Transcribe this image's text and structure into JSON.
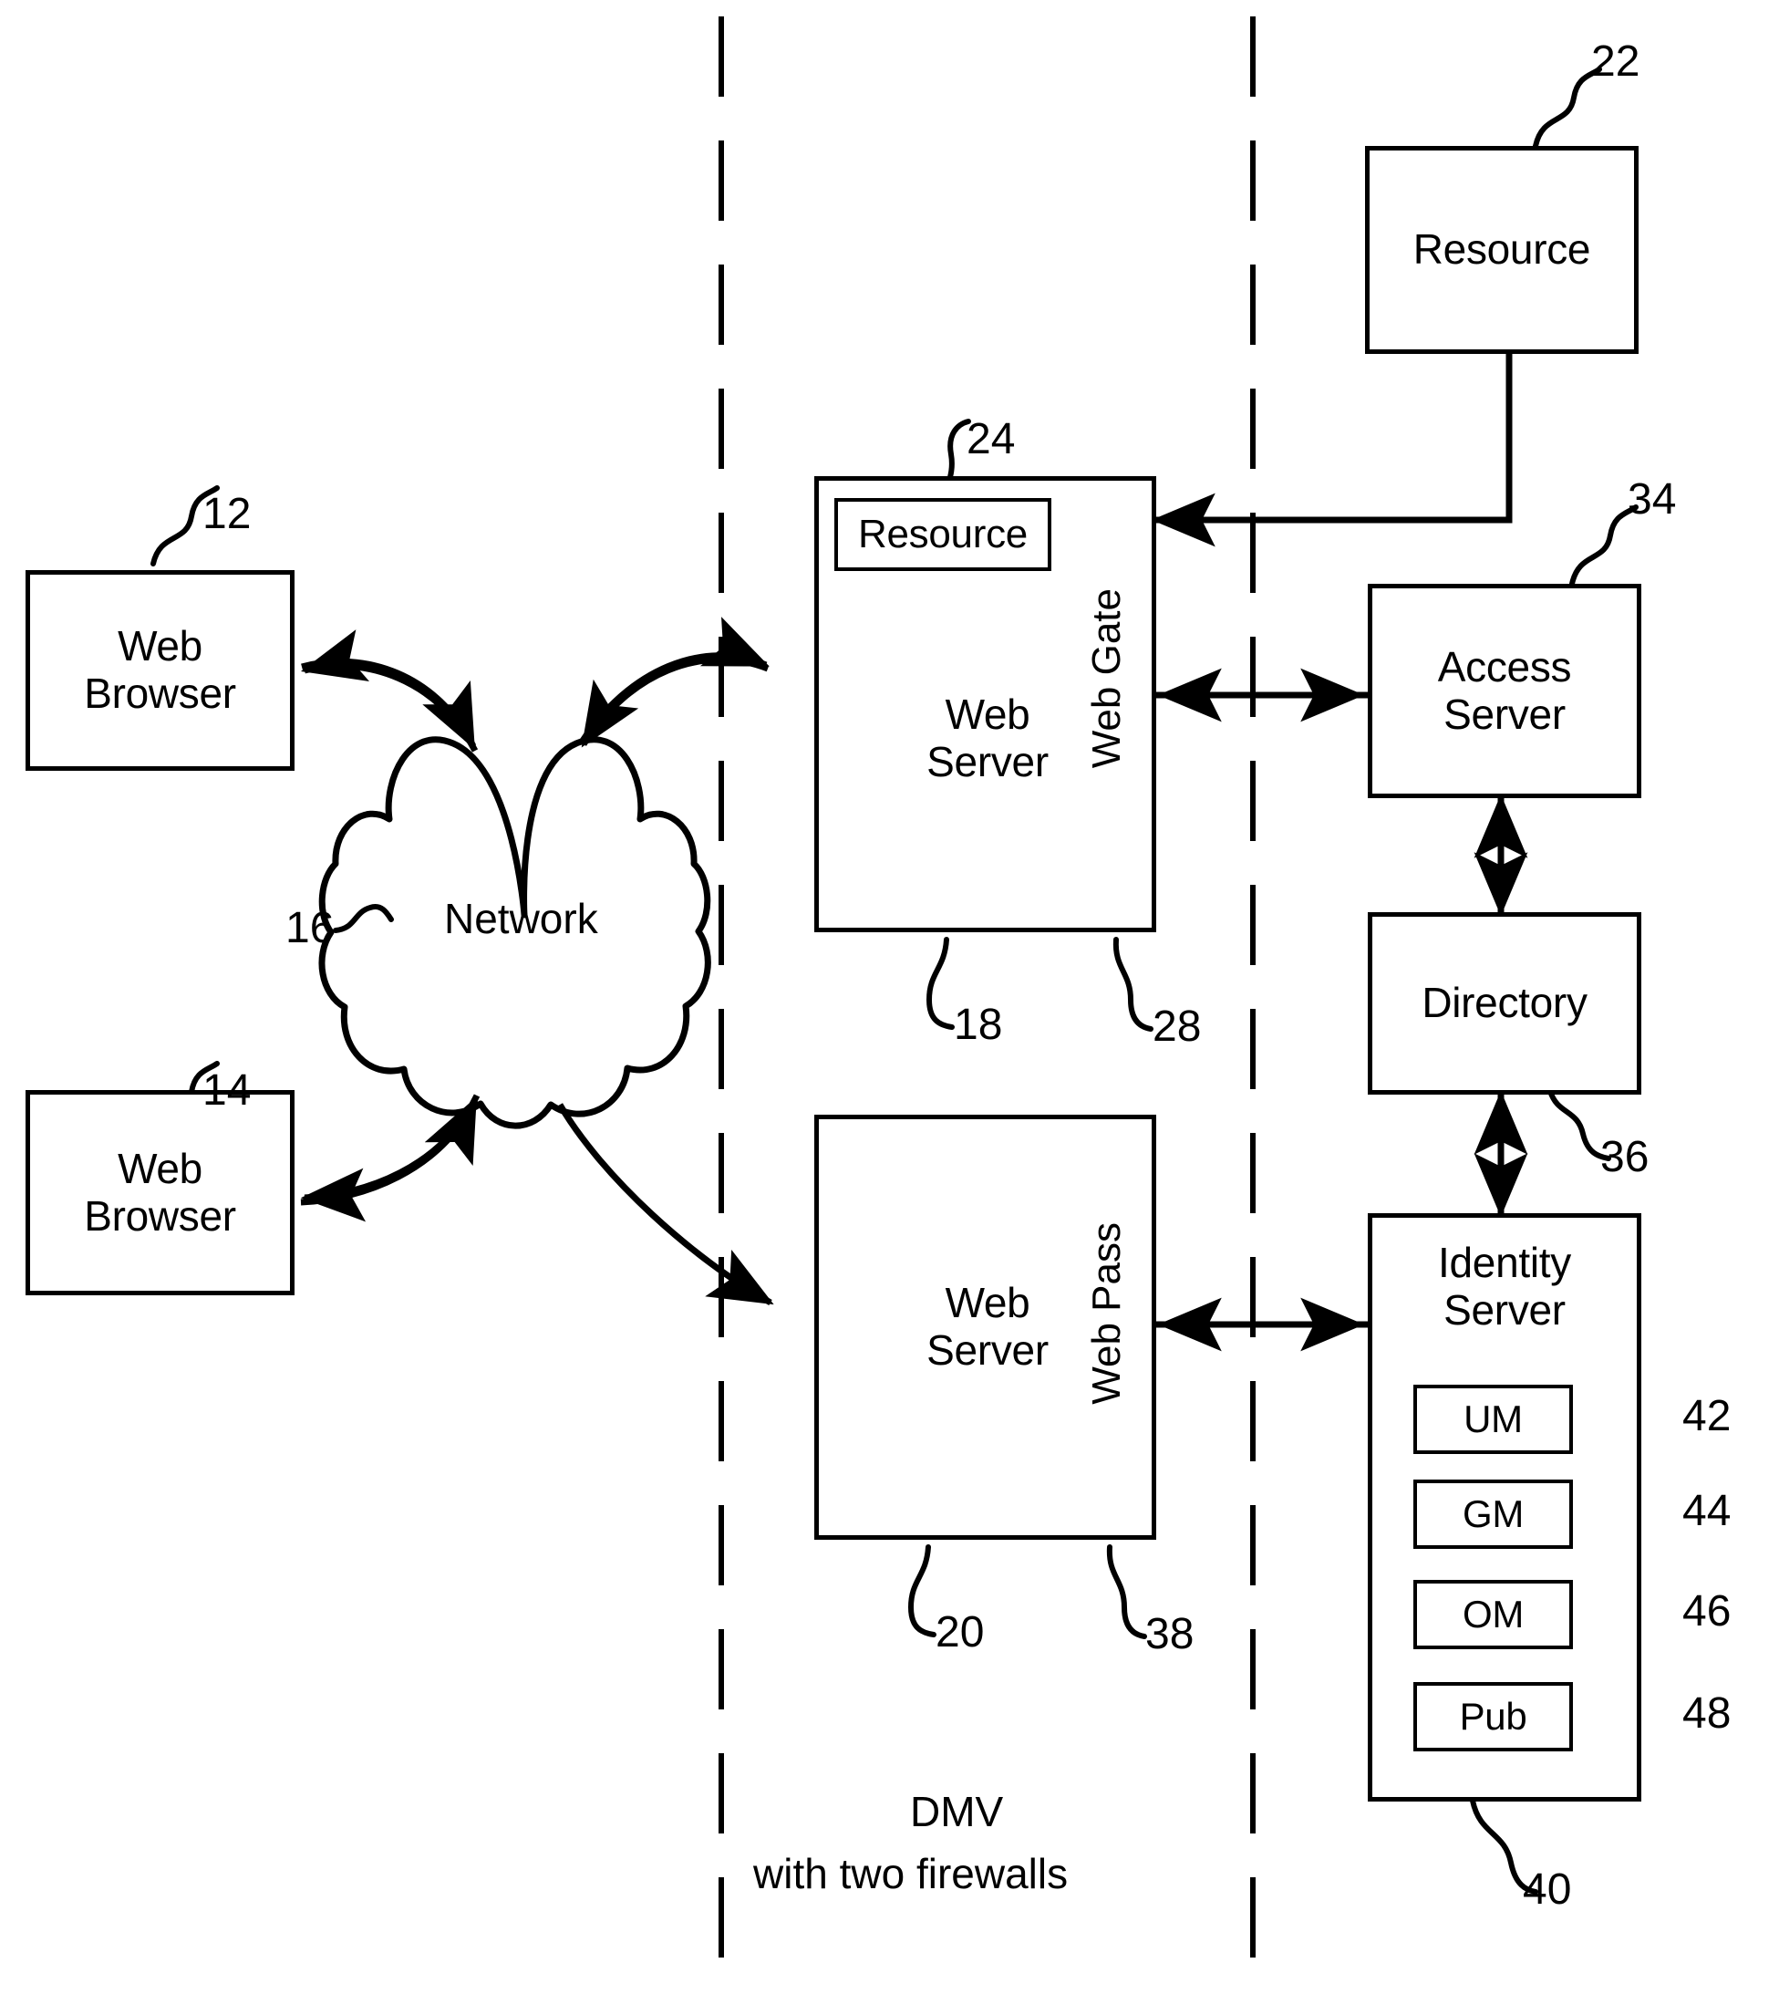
{
  "figure": {
    "title": "DMV with two firewalls network architecture",
    "stroke_color": "#000000",
    "background_color": "#ffffff"
  },
  "zones": {
    "center_caption_line1": "DMV",
    "center_caption_line2": "with  two firewalls",
    "firewall_left_name": "firewall-dashed-line-left",
    "firewall_right_name": "firewall-dashed-line-right"
  },
  "nodes": {
    "web_browser_top": {
      "label_line1": "Web",
      "label_line2": "Browser",
      "ref": "12"
    },
    "web_browser_bottom": {
      "label_line1": "Web",
      "label_line2": "Browser",
      "ref": "14"
    },
    "network": {
      "label": "Network",
      "ref": "16"
    },
    "web_server_top": {
      "label_line1": "Web",
      "label_line2": "Server",
      "ref": "18"
    },
    "web_gate": {
      "label": "Web Gate",
      "ref": "28"
    },
    "resource_inner": {
      "label": "Resource",
      "ref": "24"
    },
    "resource_external": {
      "label": "Resource",
      "ref": "22"
    },
    "access_server": {
      "label_line1": "Access",
      "label_line2": "Server",
      "ref": "34"
    },
    "directory": {
      "label": "Directory",
      "ref": "36"
    },
    "identity_server": {
      "label_line1": "Identity",
      "label_line2": "Server",
      "ref": "40"
    },
    "web_server_bottom": {
      "label_line1": "Web",
      "label_line2": "Server",
      "ref": "20"
    },
    "web_pass": {
      "label": "Web Pass",
      "ref": "38"
    },
    "identity_modules": [
      {
        "label": "UM",
        "ref": "42"
      },
      {
        "label": "GM",
        "ref": "44"
      },
      {
        "label": "OM",
        "ref": "46"
      },
      {
        "label": "Pub",
        "ref": "48"
      }
    ]
  }
}
